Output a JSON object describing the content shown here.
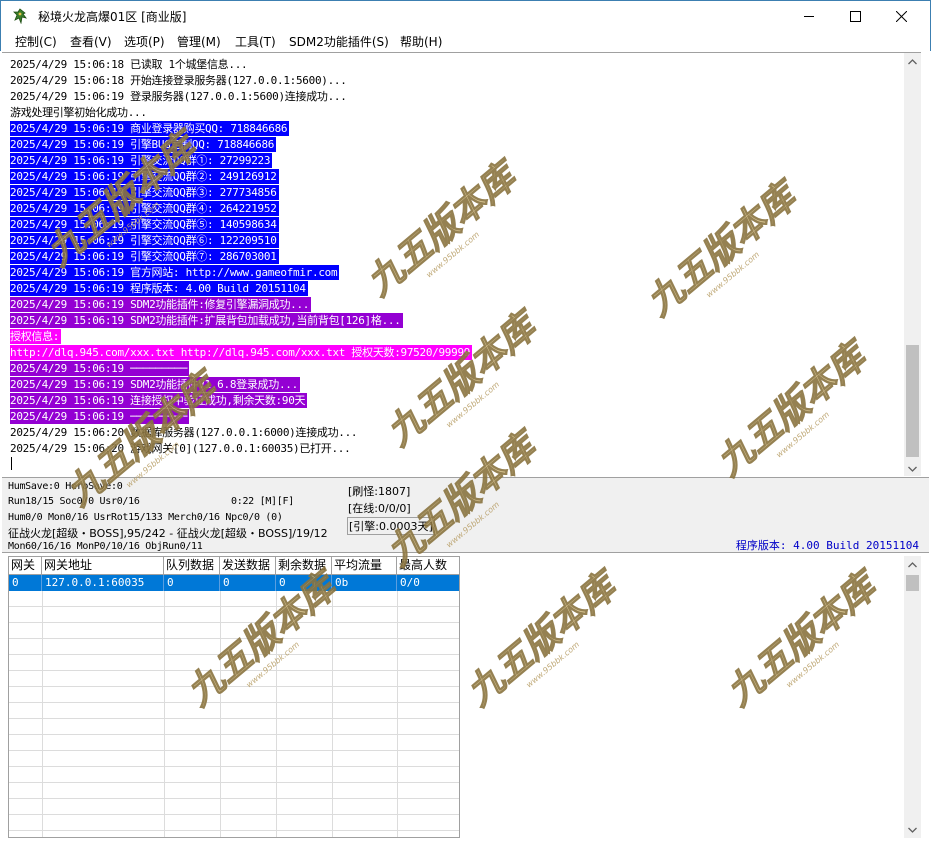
{
  "window": {
    "title": "秘境火龙高爆01区 [商业版]",
    "icon": "dragon-app-icon",
    "controls": [
      "minimize-icon",
      "maximize-icon",
      "close-icon"
    ]
  },
  "menu": [
    {
      "label": "控制(C)"
    },
    {
      "label": "查看(V)"
    },
    {
      "label": "选项(P)"
    },
    {
      "label": "管理(M)"
    },
    {
      "label": "工具(T)"
    },
    {
      "label": "SDM2功能插件(S)"
    },
    {
      "label": "帮助(H)"
    }
  ],
  "log": {
    "lines": [
      {
        "text": "2025/4/29 15:06:18 已读取 1个城堡信息...",
        "bg": "",
        "color": "#000000"
      },
      {
        "text": "2025/4/29 15:06:18 开始连接登录服务器(127.0.0.1:5600)...",
        "bg": "",
        "color": "#000000"
      },
      {
        "text": "2025/4/29 15:06:19 登录服务器(127.0.0.1:5600)连接成功...",
        "bg": "",
        "color": "#000000"
      },
      {
        "text": "游戏处理引擎初始化成功...",
        "bg": "",
        "color": "#000000"
      },
      {
        "text": "2025/4/29 15:06:19 商业登录器购买QQ: 718846686",
        "bg": "#0000ff",
        "color": "#ffffff"
      },
      {
        "text": "2025/4/29 15:06:19 引擎BUG定制QQ: 718846686",
        "bg": "#0000ff",
        "color": "#ffffff"
      },
      {
        "text": "2025/4/29 15:06:19 引擎交流QQ群①: 27299223",
        "bg": "#0000ff",
        "color": "#ffffff"
      },
      {
        "text": "2025/4/29 15:06:19 引擎交流QQ群②: 249126912",
        "bg": "#0000ff",
        "color": "#ffffff"
      },
      {
        "text": "2025/4/29 15:06:19 引擎交流QQ群③: 277734856",
        "bg": "#0000ff",
        "color": "#ffffff"
      },
      {
        "text": "2025/4/29 15:06:19 引擎交流QQ群④: 264221952",
        "bg": "#0000ff",
        "color": "#ffffff"
      },
      {
        "text": "2025/4/29 15:06:19 引擎交流QQ群⑤: 140598634",
        "bg": "#0000ff",
        "color": "#ffffff"
      },
      {
        "text": "2025/4/29 15:06:19 引擎交流QQ群⑥: 122209510",
        "bg": "#0000ff",
        "color": "#ffffff"
      },
      {
        "text": "2025/4/29 15:06:19 引擎交流QQ群⑦: 286703001",
        "bg": "#0000ff",
        "color": "#ffffff"
      },
      {
        "text": "2025/4/29 15:06:19 官方网站: http://www.gameofmir.com",
        "bg": "#0000ff",
        "color": "#ffffff"
      },
      {
        "text": "2025/4/29 15:06:19 程序版本: 4.00 Build 20151104",
        "bg": "#0000ff",
        "color": "#ffffff"
      },
      {
        "text": "2025/4/29 15:06:19 SDM2功能插件:修复引擎漏洞成功...",
        "bg": "#9400d3",
        "color": "#ffffff"
      },
      {
        "text": "2025/4/29 15:06:19 SDM2功能插件:扩展背包加载成功,当前背包[126]格...",
        "bg": "#9400d3",
        "color": "#ffffff"
      },
      {
        "text": "授权信息:",
        "bg": "#ff00ff",
        "color": "#ffffff"
      },
      {
        "text": "http://dlq.945.com/xxx.txt http://dlq.945.com/xxx.txt 授权天数:97520/99999",
        "bg": "#ff00ff",
        "color": "#ffffff"
      },
      {
        "text": "2025/4/29 15:06:19 ─────────",
        "bg": "#9400d3",
        "color": "#ffffff"
      },
      {
        "text": "2025/4/29 15:06:19 SDM2功能插件V1.6.8登录成功...",
        "bg": "#9400d3",
        "color": "#ffffff"
      },
      {
        "text": "2025/4/29 15:06:19 连接授权中验证成功,剩余天数:90天",
        "bg": "#9400d3",
        "color": "#ffffff"
      },
      {
        "text": "2025/4/29 15:06:19 ─────────",
        "bg": "#9400d3",
        "color": "#ffffff"
      },
      {
        "text": "2025/4/29 15:06:20 数据库服务器(127.0.0.1:6000)连接成功...",
        "bg": "",
        "color": "#000000"
      },
      {
        "text": "2025/4/29 15:06:20 游戏网关[0](127.0.0.1:60035)已打开...",
        "bg": "",
        "color": "#000000"
      }
    ]
  },
  "status": {
    "line1": "HumSave:0 HeroSave:0",
    "line2": "Run18/15 Soc0/0 Usr0/16",
    "line3": "Hum0/0 Mon0/16 UsrRot15/133 Merch0/16 Npc0/0 (0)",
    "line4": "征战火龙[超级・BOSS],95/242 - 征战火龙[超级・BOSS]/19/12",
    "line5": "Mon60/16/16 MonP0/10/16 ObjRun0/11",
    "timer": "0:22 [M][F]",
    "refresh_monsters": "[刷怪:1807]",
    "online": "[在线:0/0/0]",
    "engine": "[引擎:0.0003天]",
    "version": "程序版本: 4.00 Build 20151104"
  },
  "gate_table": {
    "columns": [
      "网关",
      "网关地址",
      "队列数据",
      "发送数据",
      "剩余数据",
      "平均流量",
      "最高人数"
    ],
    "rows": [
      [
        "0",
        "127.0.0.1:60035",
        "0",
        "0",
        "0",
        "0b",
        "0/0"
      ]
    ]
  },
  "watermark": {
    "text": "九五版本库",
    "sub": "www.95bbk.com"
  },
  "colors": {
    "blue_highlight": "#0000ff",
    "purple_highlight": "#9400d3",
    "magenta_highlight": "#ff00ff",
    "selection": "#0078d7",
    "version_text": "#0000c8"
  }
}
